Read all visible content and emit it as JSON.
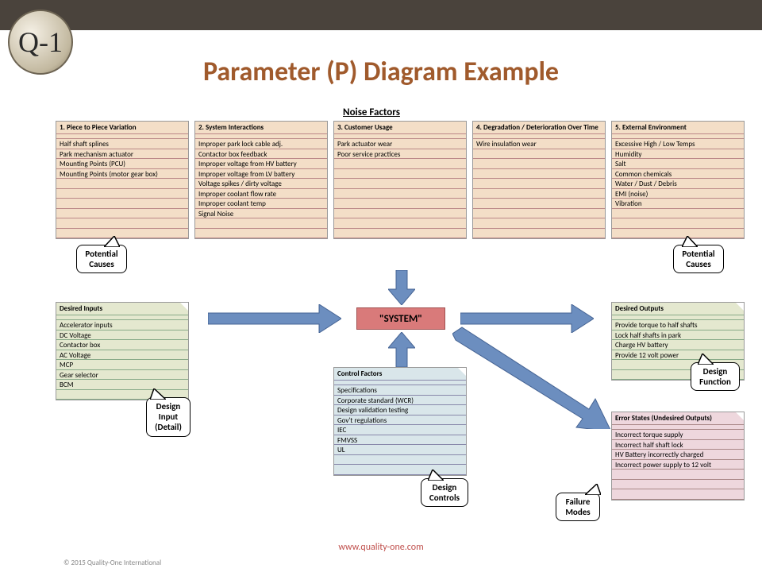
{
  "logo_text": "Q-1",
  "title": "Parameter (P) Diagram Example",
  "noise_factors_label": "Noise Factors",
  "system_label": "\"SYSTEM\"",
  "noise_factors": [
    {
      "header": "1. Piece to Piece Variation",
      "items": [
        "Half shaft splines",
        "Park mechanism actuator",
        "Mounting Points (PCU)",
        "Mounting Points (motor gear box)"
      ]
    },
    {
      "header": "2. System Interactions",
      "items": [
        "Improper park lock cable adj.",
        "Contactor box feedback",
        "Improper voltage from HV battery",
        "Improper voltage from LV battery",
        "Voltage spikes / dirty voltage",
        "Improper coolant flow rate",
        "Improper coolant temp",
        "Signal Noise"
      ]
    },
    {
      "header": "3. Customer Usage",
      "items": [
        "Park actuator wear",
        "Poor service practices"
      ]
    },
    {
      "header": "4. Degradation / Deterioration Over Time",
      "items": [
        "Wire insulation wear"
      ]
    },
    {
      "header": "5. External Environment",
      "items": [
        "Excessive High / Low Temps",
        "Humidity",
        "Salt",
        "Common chemicals",
        "Water / Dust / Debris",
        "EMI (noise)",
        "Vibration"
      ]
    }
  ],
  "desired_inputs": {
    "header": "Desired Inputs",
    "items": [
      "Accelerator inputs",
      "DC Voltage",
      "Contactor box",
      "AC Voltage",
      "MCP",
      "Gear selector",
      "BCM"
    ]
  },
  "control_factors": {
    "header": "Control Factors",
    "items": [
      "Specifications",
      "Corporate standard (WCR)",
      "Design validation testing",
      "Gov't regulations",
      "IEC",
      "FMVSS",
      "UL"
    ]
  },
  "desired_outputs": {
    "header": "Desired Outputs",
    "items": [
      "Provide torque to half shafts",
      "Lock half shafts in park",
      "Charge HV battery",
      "Provide 12 volt power"
    ]
  },
  "error_states": {
    "header": "Error States (Undesired Outputs)",
    "items": [
      "Incorrect torque supply",
      "Incorrect half shaft lock",
      "HV Battery incorrectly charged",
      "Incorrect power supply to 12 volt"
    ]
  },
  "callouts": {
    "potential_causes": "Potential\nCauses",
    "design_input": "Design\nInput\n(Detail)",
    "design_controls": "Design\nControls",
    "design_function": "Design\nFunction",
    "failure_modes": "Failure\nModes"
  },
  "footer_url": "www.quality-one.com",
  "copyright": "© 2015 Quality-One International"
}
